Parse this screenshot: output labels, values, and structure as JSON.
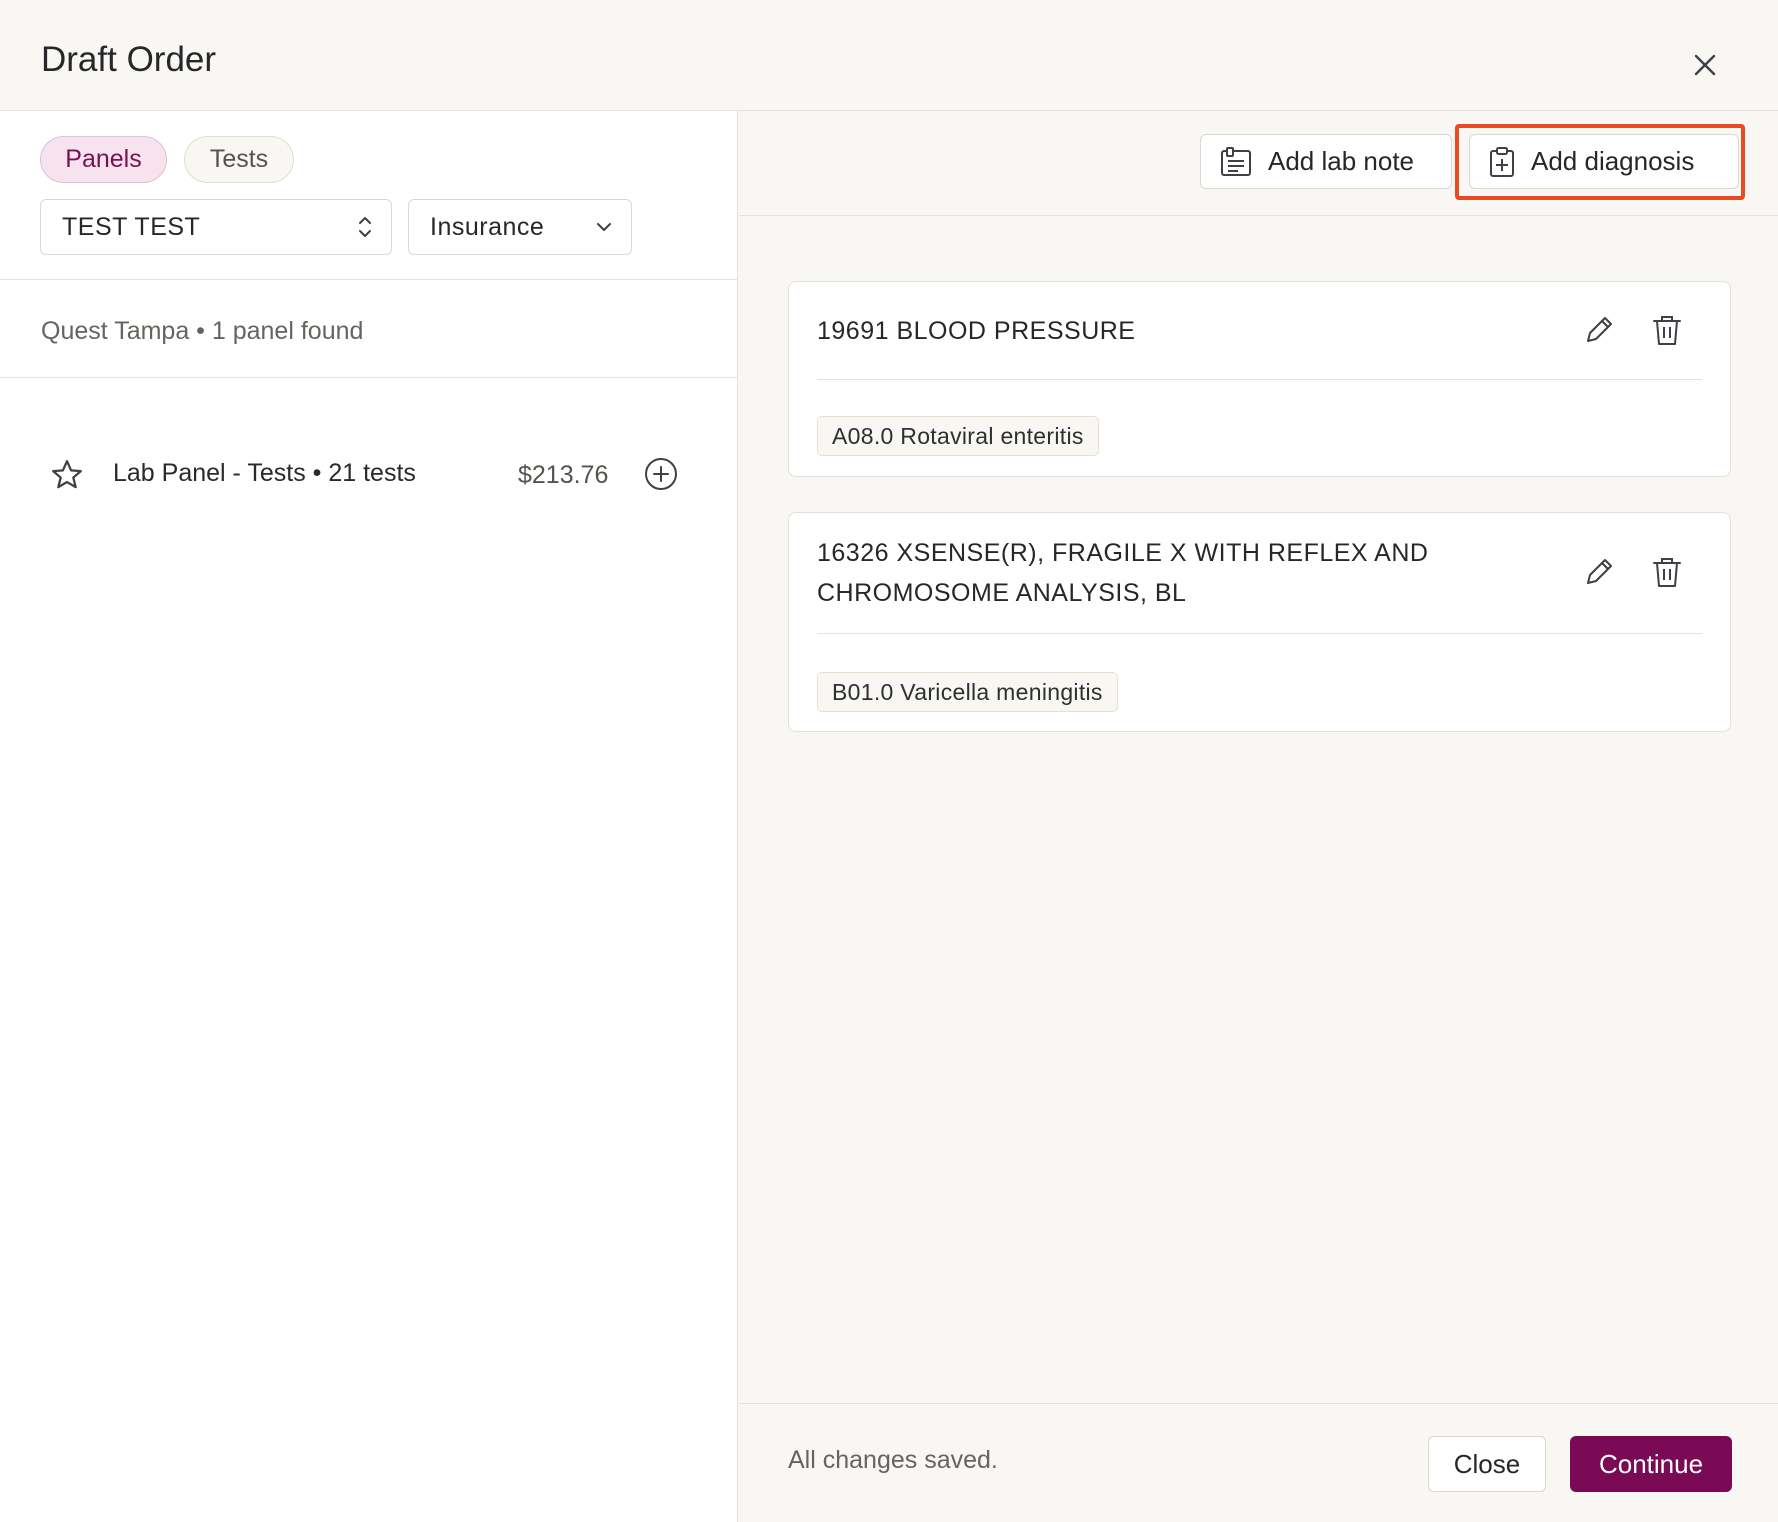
{
  "header": {
    "title": "Draft Order"
  },
  "left": {
    "tabs": [
      {
        "label": "Panels",
        "active": true
      },
      {
        "label": "Tests",
        "active": false
      }
    ],
    "patient_select": {
      "value": "TEST TEST"
    },
    "coverage_select": {
      "value": "Insurance"
    },
    "summary": "Quest Tampa • 1 panel found",
    "panels": [
      {
        "name": "Lab Panel - Tests • 21 tests",
        "price": "$213.76"
      }
    ]
  },
  "toolbar": {
    "add_lab_note": "Add lab note",
    "add_diagnosis": "Add diagnosis"
  },
  "orders": [
    {
      "title": "19691 BLOOD PRESSURE",
      "diagnosis": "A08.0 Rotaviral enteritis"
    },
    {
      "title": "16326 XSENSE(R), FRAGILE X WITH REFLEX AND CHROMOSOME ANALYSIS, BL",
      "diagnosis": "B01.0 Varicella meningitis"
    }
  ],
  "footer": {
    "status": "All changes saved.",
    "close_label": "Close",
    "continue_label": "Continue"
  },
  "colors": {
    "accent": "#7a0a55",
    "highlight": "#e84a24"
  }
}
